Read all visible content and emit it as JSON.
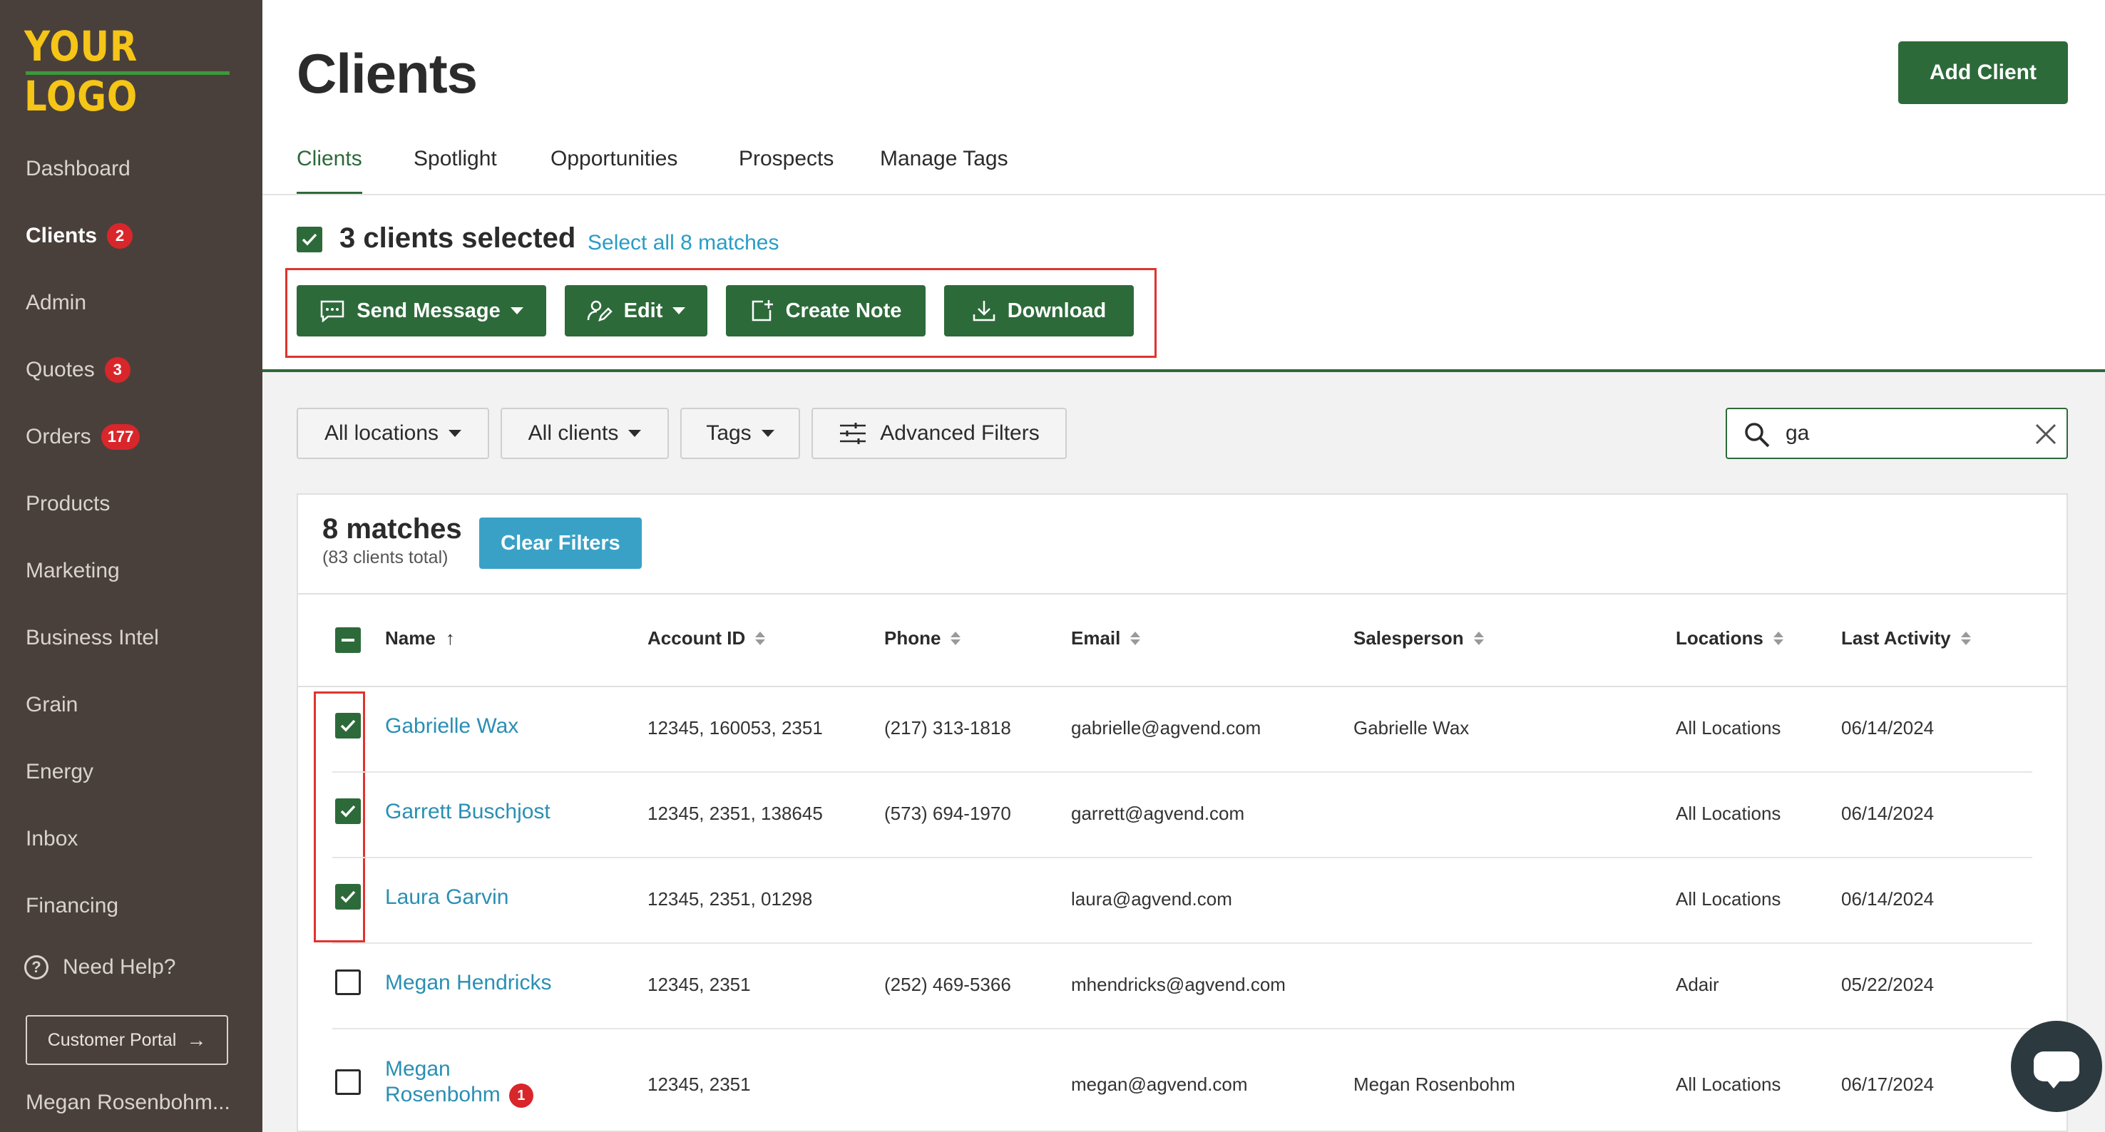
{
  "sidebar": {
    "logo": "YOUR LOGO",
    "items": [
      {
        "label": "Dashboard",
        "badge": ""
      },
      {
        "label": "Clients",
        "badge": "2"
      },
      {
        "label": "Admin",
        "badge": ""
      },
      {
        "label": "Quotes",
        "badge": "3"
      },
      {
        "label": "Orders",
        "badge": "177"
      },
      {
        "label": "Products",
        "badge": ""
      },
      {
        "label": "Marketing",
        "badge": ""
      },
      {
        "label": "Business Intel",
        "badge": ""
      },
      {
        "label": "Grain",
        "badge": ""
      },
      {
        "label": "Energy",
        "badge": ""
      },
      {
        "label": "Inbox",
        "badge": ""
      },
      {
        "label": "Financing",
        "badge": ""
      }
    ],
    "help": "Need Help?",
    "portal_button": "Customer Portal",
    "user": "Megan Rosenbohm..."
  },
  "header": {
    "title": "Clients",
    "add_button": "Add Client"
  },
  "tabs": [
    "Clients",
    "Spotlight",
    "Opportunities",
    "Prospects",
    "Manage Tags"
  ],
  "selection": {
    "text": "3 clients selected",
    "select_all": "Select all 8 matches"
  },
  "actions": {
    "send_message": "Send Message",
    "edit": "Edit",
    "create_note": "Create Note",
    "download": "Download"
  },
  "filters": {
    "locations": "All locations",
    "clients": "All clients",
    "tags": "Tags",
    "advanced": "Advanced Filters",
    "search_value": "ga"
  },
  "results": {
    "matches": "8 matches",
    "total": "(83 clients total)",
    "clear": "Clear Filters"
  },
  "columns": {
    "name": "Name",
    "account": "Account ID",
    "phone": "Phone",
    "email": "Email",
    "salesperson": "Salesperson",
    "locations": "Locations",
    "activity": "Last Activity"
  },
  "rows": [
    {
      "name": "Gabrielle Wax",
      "account": "12345, 160053, 2351",
      "phone": "(217) 313-1818",
      "email": "gabrielle@agvend.com",
      "salesperson": "Gabrielle Wax",
      "locations": "All Locations",
      "activity": "06/14/2024",
      "checked": true
    },
    {
      "name": "Garrett Buschjost",
      "account": "12345, 2351, 138645",
      "phone": "(573) 694-1970",
      "email": "garrett@agvend.com",
      "salesperson": "",
      "locations": "All Locations",
      "activity": "06/14/2024",
      "checked": true
    },
    {
      "name": "Laura Garvin",
      "account": "12345, 2351, 01298",
      "phone": "",
      "email": "laura@agvend.com",
      "salesperson": "",
      "locations": "All Locations",
      "activity": "06/14/2024",
      "checked": true
    },
    {
      "name": "Megan Hendricks",
      "account": "12345, 2351",
      "phone": "(252) 469-5366",
      "email": "mhendricks@agvend.com",
      "salesperson": "",
      "locations": "Adair",
      "activity": "05/22/2024",
      "checked": false
    },
    {
      "name_line1": "Megan",
      "name_line2": "Rosenbohm",
      "name_badge": "1",
      "account": "12345, 2351",
      "phone": "",
      "email": "megan@agvend.com",
      "salesperson": "Megan Rosenbohm",
      "locations": "All Locations",
      "activity": "06/17/2024",
      "checked": false
    }
  ],
  "colors": {
    "sidebar": "#4a403b",
    "brand_green": "#2d6a3a",
    "link_blue": "#2a8fb4",
    "badge_red": "#d9262b",
    "logo_yellow": "#f5c517"
  }
}
